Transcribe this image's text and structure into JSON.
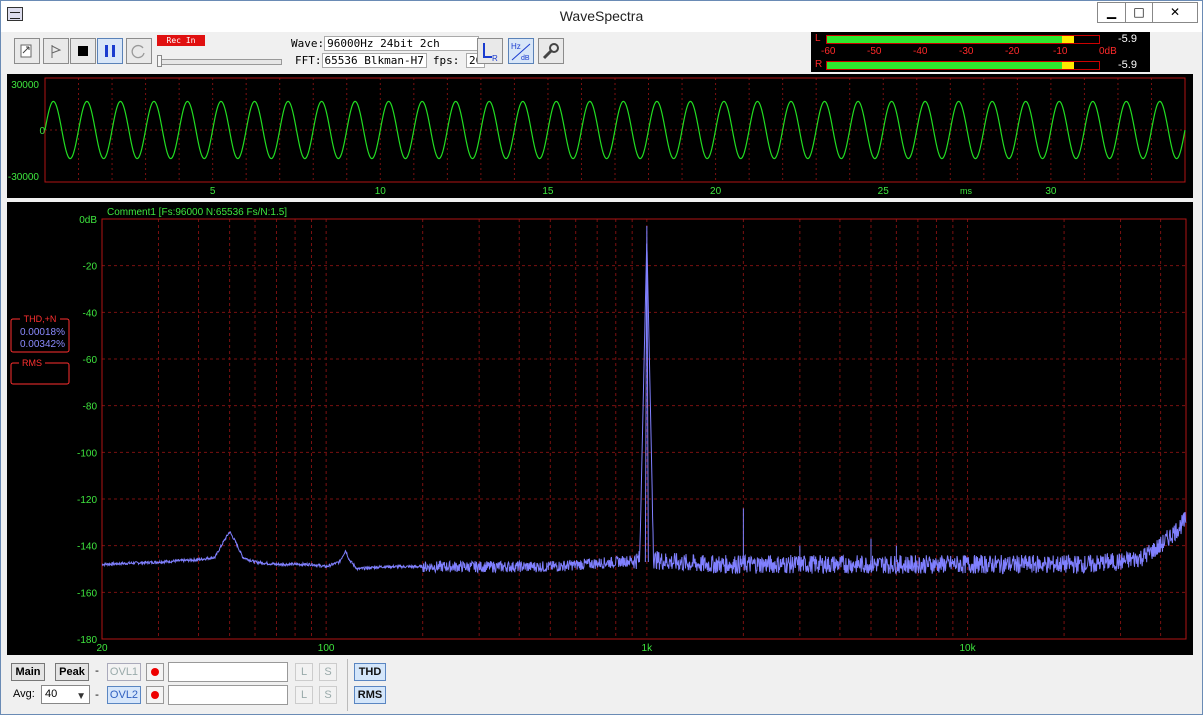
{
  "window": {
    "title": "WaveSpectra",
    "min_glyph": "▁",
    "max_glyph": "□",
    "close_glyph": "✕"
  },
  "toolbar": {
    "buttons": [
      "open-file",
      "marker",
      "stop",
      "pause",
      "reset"
    ],
    "rec_in_label": "Rec In",
    "wave_label": "Wave:",
    "wave_format": "96000Hz 24bit 2ch",
    "fft_label": "FFT:",
    "fft_setting": "65536 Blkman-H7",
    "fps_label": "fps:",
    "fps_value": "20"
  },
  "meter": {
    "L_label": "L",
    "R_label": "R",
    "scale": [
      "-60",
      "-50",
      "-40",
      "-30",
      "-20",
      "-10",
      "0dB"
    ],
    "L_value": "-5.9",
    "R_value": "-5.9",
    "L_level_db": -5.9,
    "R_level_db": -5.9,
    "colors": {
      "green": "#2ee82e",
      "yellow": "#ffe800",
      "red": "#ff2a2a"
    }
  },
  "wave_panel": {
    "ylabels": [
      "30000",
      "0",
      "-30000"
    ],
    "xlabels": [
      "5",
      "10",
      "15",
      "20",
      "25",
      "30"
    ],
    "x_unit": "ms",
    "colors": {
      "trace": "#22dd22",
      "grid": "#8a1010"
    }
  },
  "spectrum_panel": {
    "comment": "Comment1   [Fs:96000 N:65536 Fs/N:1.5]",
    "ylabels": [
      "0dB",
      "-20",
      "-40",
      "-60",
      "-80",
      "-100",
      "-120",
      "-140",
      "-160",
      "-180"
    ],
    "xlabels": [
      "20",
      "100",
      "1k",
      "10k"
    ],
    "thd_title": "THD,+N",
    "thd_values": [
      "0.00018%",
      "0.00342%"
    ],
    "rms_title": "RMS",
    "colors": {
      "trace": "#8080ff",
      "grid": "#8a1010"
    }
  },
  "chart_data": [
    {
      "type": "line",
      "title": "",
      "xlabel": "ms",
      "ylabel": "",
      "xlim": [
        0,
        34
      ],
      "ylim": [
        -30000,
        30000
      ],
      "series": [
        {
          "frequency_hz": 1000,
          "amplitude": 16500
        }
      ],
      "grid": true
    },
    {
      "type": "line",
      "title": "",
      "xlabel": "",
      "ylabel": "",
      "xscale": "log",
      "xlim": [
        20,
        48000
      ],
      "ylim": [
        -180,
        0
      ],
      "series": [
        {
          "x": [
            20,
            30,
            40,
            45,
            48,
            50,
            52,
            55,
            60,
            70,
            90,
            100,
            110,
            115,
            118,
            125,
            150,
            200,
            300,
            500,
            800,
            950,
            1000,
            1050,
            1200,
            1500,
            2000,
            3000,
            5000,
            8000,
            10000,
            15000,
            20000,
            25000,
            27000,
            30000,
            35000,
            40000,
            45000,
            48000
          ],
          "y": [
            -148,
            -147,
            -146,
            -145,
            -138,
            -134,
            -138,
            -145,
            -147,
            -148,
            -148,
            -149,
            -147,
            -142,
            -146,
            -150,
            -149,
            -149,
            -149,
            -149,
            -147,
            -146,
            -8,
            -146,
            -147,
            -148,
            -148,
            -148,
            -148,
            -148,
            -148,
            -148,
            -148,
            -148,
            -147,
            -147,
            -145,
            -140,
            -133,
            -129
          ]
        }
      ],
      "harmonic_peaks": [
        {
          "x": 2000,
          "y": -124
        },
        {
          "x": 3000,
          "y": -140
        },
        {
          "x": 5000,
          "y": -137
        },
        {
          "x": 6000,
          "y": -140
        }
      ],
      "grid": true
    }
  ],
  "bottom": {
    "main_label": "Main",
    "peak_label": "Peak",
    "avg_label": "Avg:",
    "avg_value": "40",
    "ovl1_label": "OVL1",
    "ovl2_label": "OVL2",
    "dash": "-",
    "l_label": "L",
    "s_label": "S",
    "thd_label": "THD",
    "rms_label": "RMS",
    "ovl1_text": "",
    "ovl2_text": ""
  }
}
